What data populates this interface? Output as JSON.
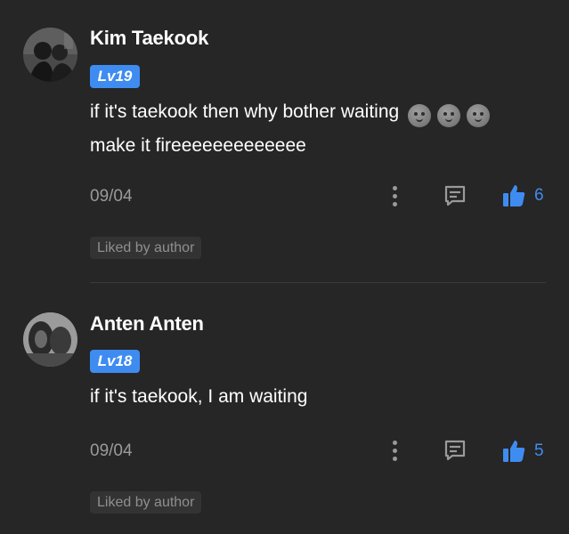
{
  "colors": {
    "background": "#262626",
    "badge": "#3f8cf0",
    "like": "#3f8cf0",
    "secondary_text": "#9a9a9a"
  },
  "comments": [
    {
      "username": "Kim Taekook",
      "level": "Lv19",
      "text_line1": "if it's taekook then why bother waiting",
      "text_line2": "make it fireeeeeeeeeeeee",
      "emojis": [
        "smile-emoji",
        "smile-emoji",
        "smile-emoji"
      ],
      "date": "09/04",
      "like_count": "6",
      "liked_tag": "Liked by author"
    },
    {
      "username": "Anten Anten",
      "level": "Lv18",
      "text_line1": "if it's taekook, I am waiting",
      "date": "09/04",
      "like_count": "5",
      "liked_tag": "Liked by author"
    }
  ]
}
